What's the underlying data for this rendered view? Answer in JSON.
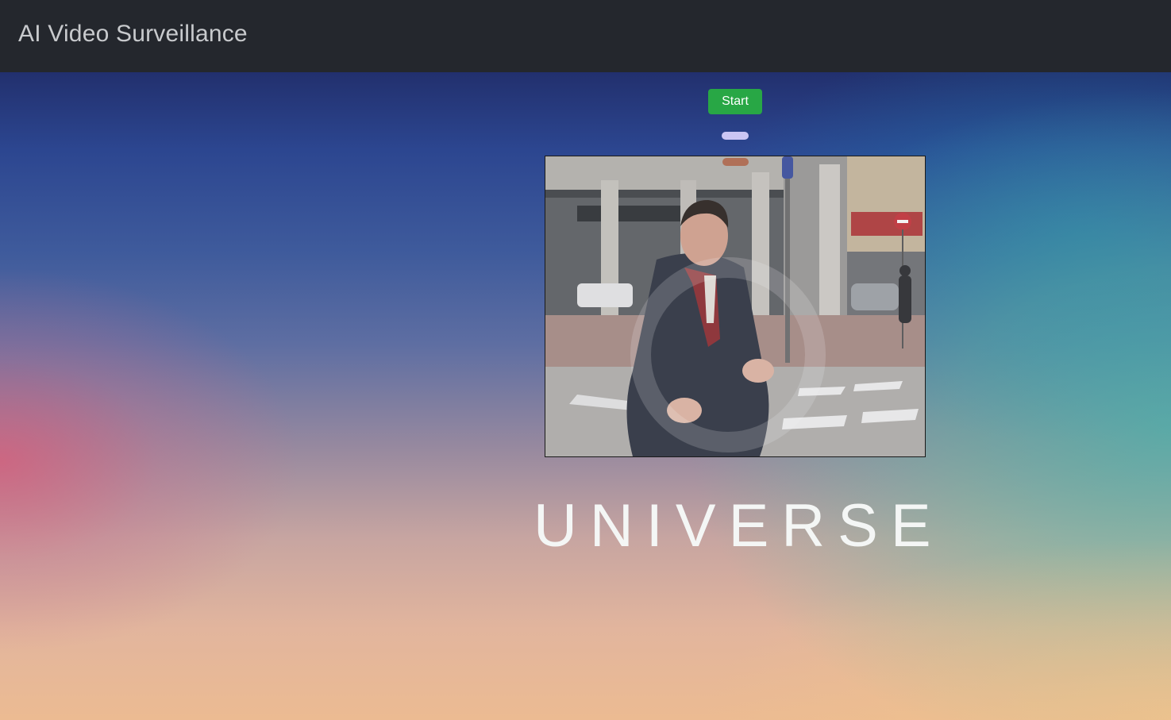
{
  "navbar": {
    "brand": "AI Video Surveillance",
    "background_color": "#24272d"
  },
  "controls": {
    "start_label": "Start",
    "start_color": "#28a745"
  },
  "video": {
    "scene": "street-video-frame"
  },
  "overlay_text": "UNIVERSE"
}
